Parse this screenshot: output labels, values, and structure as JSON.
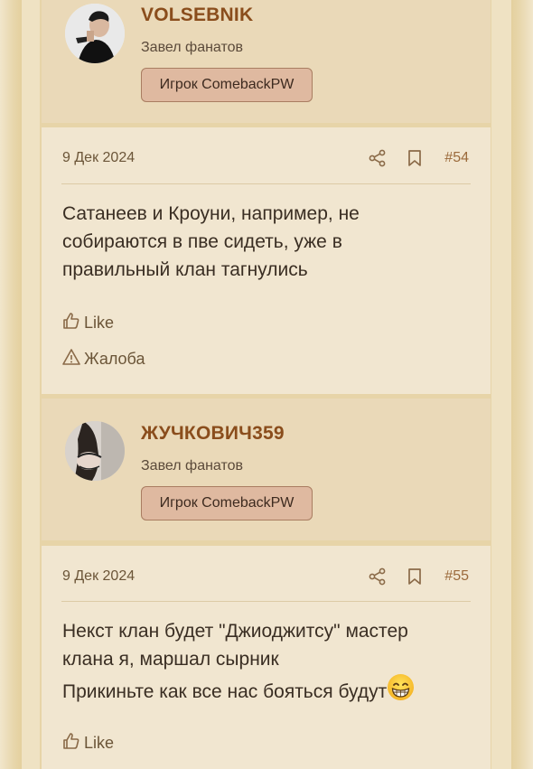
{
  "posts": [
    {
      "author": "VOLSEBNIK",
      "title": "Завел фанатов",
      "badge": "Игрок ComebackPW",
      "date": "9 Дек 2024",
      "number": "#54",
      "lines": [
        "Сатанеев и Кроуни, например, не",
        "собираются в пве сидеть, уже в",
        "правильный клан тагнулись"
      ],
      "like_label": "Like",
      "report_label": "Жалоба"
    },
    {
      "author": "ЖУЧКОВИЧ359",
      "title": "Завел фанатов",
      "badge": "Игрок ComebackPW",
      "date": "9 Дек 2024",
      "number": "#55",
      "lines": [
        "Некст клан будет \"Джиоджитсу\" мастер",
        "клана я, маршал сырник",
        "Прикиньте как все нас бояться будут"
      ],
      "emoji": "grinning-face-emoji",
      "like_label": "Like"
    }
  ],
  "icons": [
    "share-icon",
    "bookmark-icon",
    "thumbs-up-icon",
    "warning-icon"
  ],
  "colors": {
    "author": "#8a4d1c",
    "badge_bg": "#dfb9a0",
    "post_bg": "#f1e6d0",
    "author_bg": "#ead9b8"
  }
}
